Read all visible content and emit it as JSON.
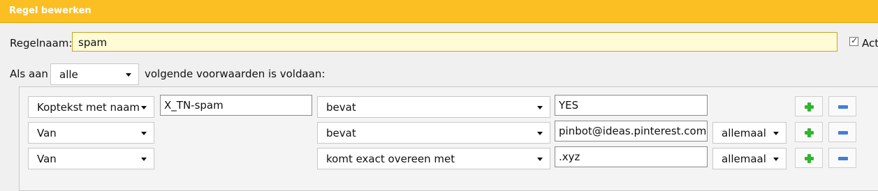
{
  "window": {
    "title": "Regel bewerken"
  },
  "rule": {
    "name_label": "Regelnaam:",
    "name_value": "spam",
    "active_label": "Act",
    "active_checked": true
  },
  "match": {
    "prefix": "Als aan",
    "mode": "alle",
    "suffix": "volgende voorwaarden is voldaan:"
  },
  "conditions": [
    {
      "field": "Koptekst met naam",
      "header_name": "X_TN-spam",
      "operator": "bevat",
      "value": "YES",
      "scope": ""
    },
    {
      "field": "Van",
      "header_name": "",
      "operator": "bevat",
      "value": "pinbot@ideas.pinterest.com",
      "scope": "allemaal"
    },
    {
      "field": "Van",
      "header_name": "",
      "operator": "komt exact overeen met",
      "value": ".xyz",
      "scope": "allemaal"
    }
  ],
  "icons": {
    "add": "plus-icon",
    "remove": "minus-icon"
  },
  "colors": {
    "titlebar": "#fbbf24",
    "add": "#2fb52f",
    "remove": "#3f7fd6",
    "name_field": "#fffbd6"
  }
}
